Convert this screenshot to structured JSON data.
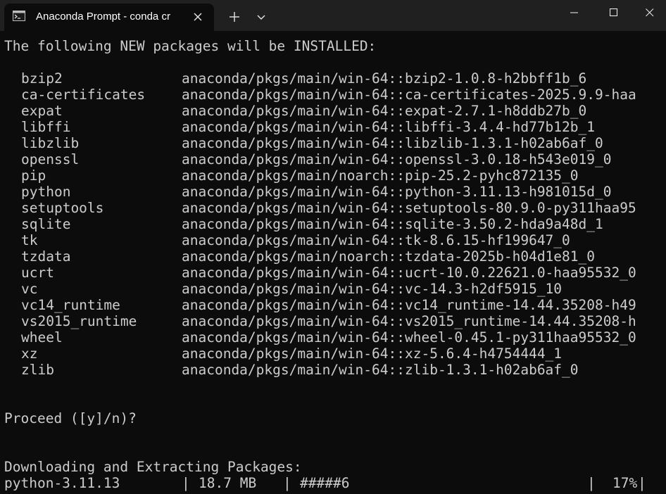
{
  "window": {
    "tab_title": "Anaconda Prompt - conda  cr",
    "tab_icon": "terminal-icon",
    "new_tab_icon": "plus-icon",
    "dropdown_icon": "chevron-down-icon",
    "controls": [
      "minimize-icon",
      "maximize-icon",
      "close-icon"
    ]
  },
  "terminal": {
    "header": "The following NEW packages will be INSTALLED:",
    "packages": [
      {
        "name": "bzip2",
        "spec": "anaconda/pkgs/main/win-64::bzip2-1.0.8-h2bbff1b_6"
      },
      {
        "name": "ca-certificates",
        "spec": "anaconda/pkgs/main/win-64::ca-certificates-2025.9.9-haa"
      },
      {
        "name": "expat",
        "spec": "anaconda/pkgs/main/win-64::expat-2.7.1-h8ddb27b_0"
      },
      {
        "name": "libffi",
        "spec": "anaconda/pkgs/main/win-64::libffi-3.4.4-hd77b12b_1"
      },
      {
        "name": "libzlib",
        "spec": "anaconda/pkgs/main/win-64::libzlib-1.3.1-h02ab6af_0"
      },
      {
        "name": "openssl",
        "spec": "anaconda/pkgs/main/win-64::openssl-3.0.18-h543e019_0"
      },
      {
        "name": "pip",
        "spec": "anaconda/pkgs/main/noarch::pip-25.2-pyhc872135_0"
      },
      {
        "name": "python",
        "spec": "anaconda/pkgs/main/win-64::python-3.11.13-h981015d_0"
      },
      {
        "name": "setuptools",
        "spec": "anaconda/pkgs/main/win-64::setuptools-80.9.0-py311haa95"
      },
      {
        "name": "sqlite",
        "spec": "anaconda/pkgs/main/win-64::sqlite-3.50.2-hda9a48d_1"
      },
      {
        "name": "tk",
        "spec": "anaconda/pkgs/main/win-64::tk-8.6.15-hf199647_0"
      },
      {
        "name": "tzdata",
        "spec": "anaconda/pkgs/main/noarch::tzdata-2025b-h04d1e81_0"
      },
      {
        "name": "ucrt",
        "spec": "anaconda/pkgs/main/win-64::ucrt-10.0.22621.0-haa95532_0"
      },
      {
        "name": "vc",
        "spec": "anaconda/pkgs/main/win-64::vc-14.3-h2df5915_10"
      },
      {
        "name": "vc14_runtime",
        "spec": "anaconda/pkgs/main/win-64::vc14_runtime-14.44.35208-h49"
      },
      {
        "name": "vs2015_runtime",
        "spec": "anaconda/pkgs/main/win-64::vs2015_runtime-14.44.35208-h"
      },
      {
        "name": "wheel",
        "spec": "anaconda/pkgs/main/win-64::wheel-0.45.1-py311haa95532_0"
      },
      {
        "name": "xz",
        "spec": "anaconda/pkgs/main/win-64::xz-5.6.4-h4754444_1"
      },
      {
        "name": "zlib",
        "spec": "anaconda/pkgs/main/win-64::zlib-1.3.1-h02ab6af_0"
      }
    ],
    "prompt": "Proceed ([y]/n)?",
    "download_header": "Downloading and Extracting Packages:",
    "progress": {
      "package": "python-3.11.13",
      "size_sep": "|",
      "size": "18.7 MB",
      "bar_sep": "|",
      "bar": "#####6",
      "pct_sep": "|",
      "percent": "17%",
      "end_sep": "|"
    }
  },
  "colors": {
    "background": "#0c0c0c",
    "titlebar": "#202020",
    "text": "#cccccc"
  }
}
